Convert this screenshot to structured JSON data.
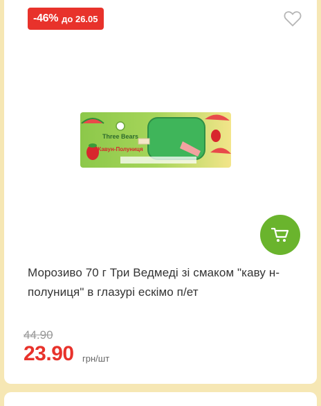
{
  "badge": {
    "discount": "-46%",
    "until": "до 26.05"
  },
  "product": {
    "image_label": "Three Bears",
    "image_flavor": "Кавун-Полуниця",
    "title": "Морозиво 70 г Три Ведмеді зі смаком \"каву н-полуниця\" в глазурі ескімо п/ет"
  },
  "price": {
    "old": "44.90",
    "new": "23.90",
    "unit": "грн/шт"
  },
  "colors": {
    "accent_red": "#e8322b",
    "cart_green": "#6ab42d",
    "page_bg": "#f6e7b4"
  },
  "icons": {
    "favorite": "heart-outline-icon",
    "cart": "cart-icon"
  }
}
